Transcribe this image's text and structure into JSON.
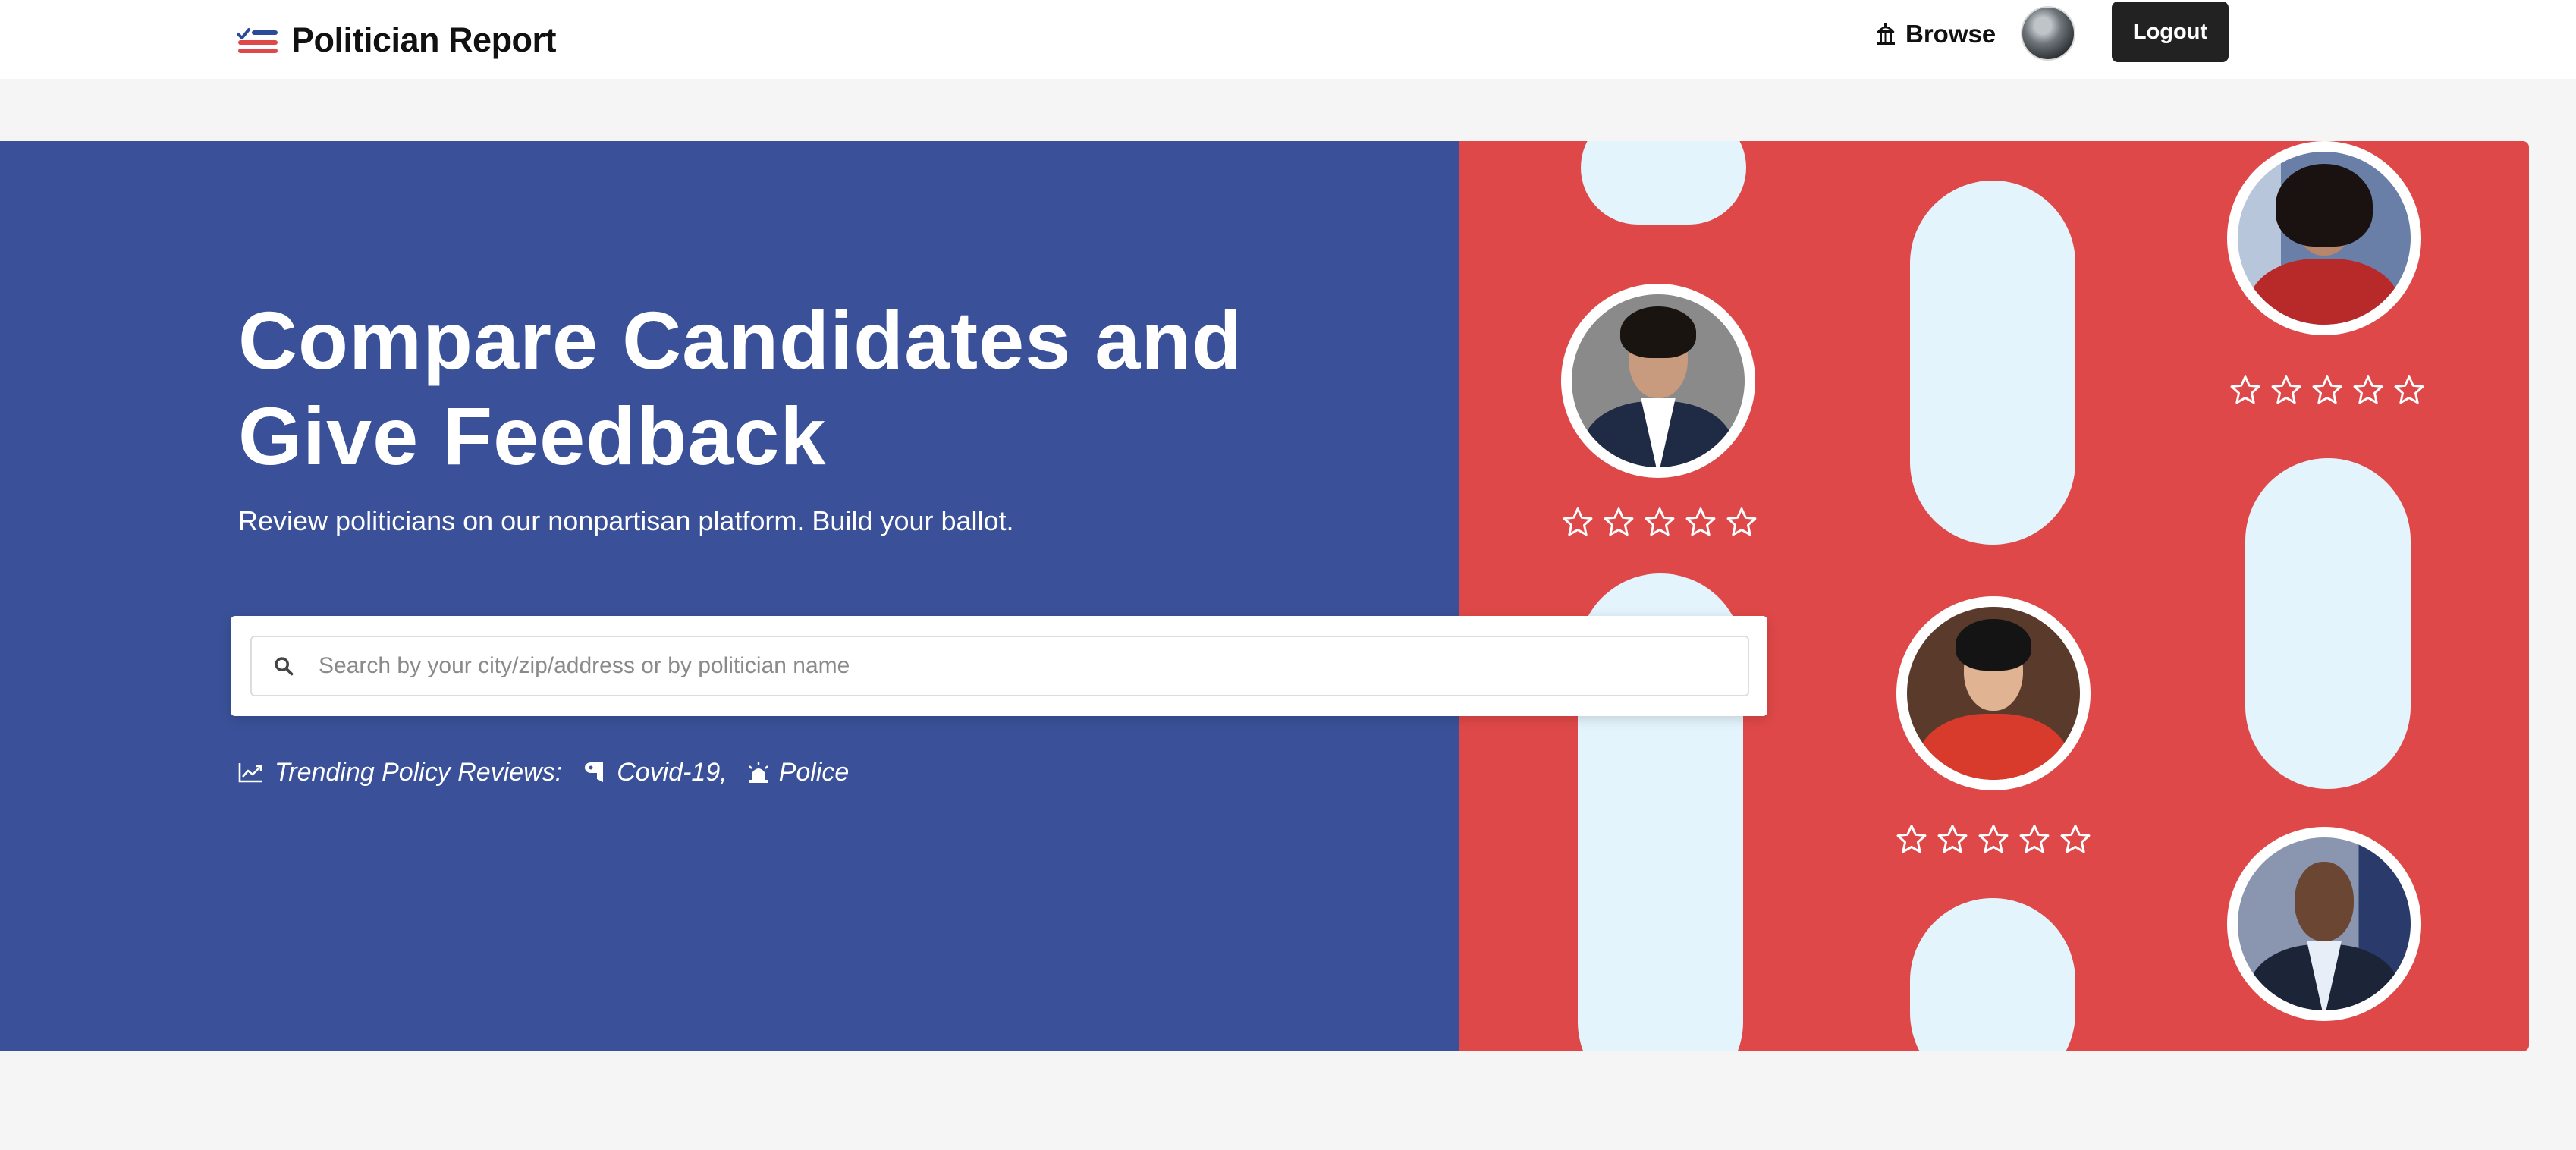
{
  "header": {
    "brand_name": "Politician Report",
    "browse_label": "Browse",
    "logout_label": "Logout"
  },
  "hero": {
    "title": "Compare Candidates and Give Feedback",
    "subtitle": "Review politicians on our nonpartisan platform. Build your ballot.",
    "search_placeholder": "Search by your city/zip/address or by politician name",
    "trending_label": "Trending Policy Reviews:",
    "trending_items": [
      {
        "label": "Covid-19,",
        "icon": "toilet-paper-icon"
      },
      {
        "label": "Police",
        "icon": "siren-icon"
      }
    ]
  },
  "colors": {
    "brand_blue": "#3a5199",
    "brand_red": "#df4848",
    "pill_light_blue": "#e4f4fc",
    "logout_bg": "#222222"
  },
  "politician_cards": [
    {
      "rating": 0,
      "max": 5
    },
    {
      "rating": 0,
      "max": 5
    },
    {
      "rating": 0,
      "max": 5
    },
    {
      "rating": 0,
      "max": 5
    }
  ]
}
